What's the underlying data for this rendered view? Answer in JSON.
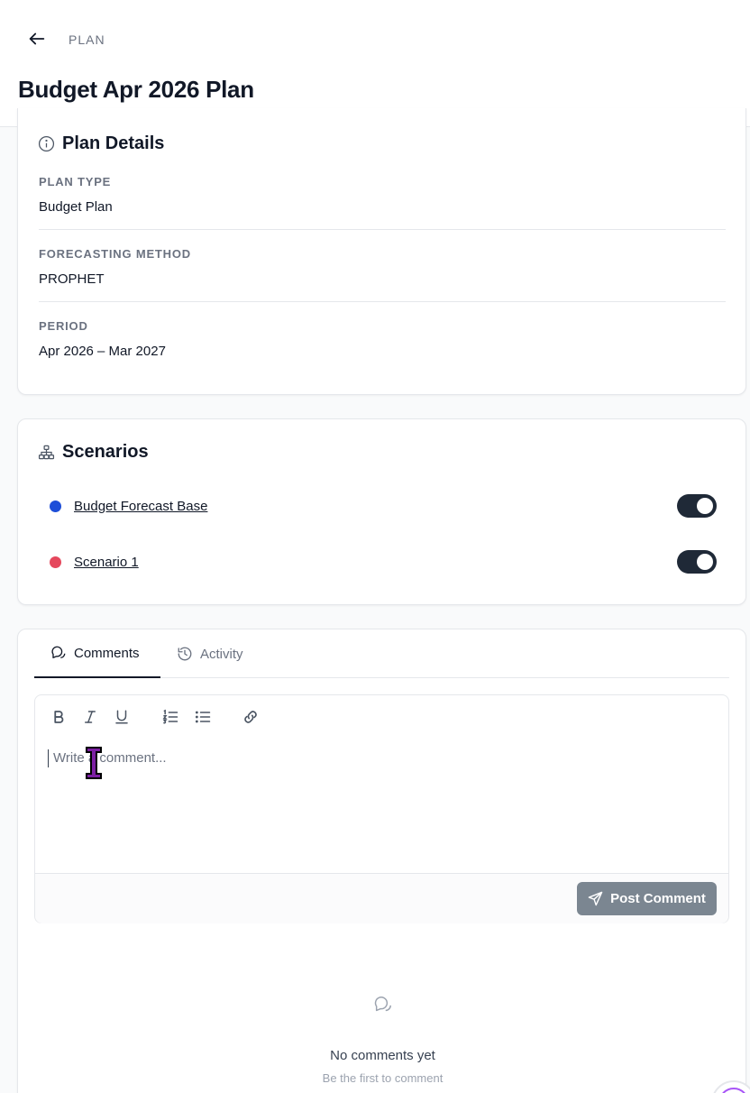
{
  "header": {
    "breadcrumb": "PLAN",
    "title": "Budget Apr 2026 Plan"
  },
  "details": {
    "title": "Plan Details",
    "fields": [
      {
        "label": "PLAN TYPE",
        "value": "Budget Plan"
      },
      {
        "label": "FORECASTING METHOD",
        "value": "PROPHET"
      },
      {
        "label": "PERIOD",
        "value": "Apr 2026 – Mar 2027"
      }
    ]
  },
  "scenarios": {
    "title": "Scenarios",
    "items": [
      {
        "name": "Budget Forecast Base",
        "color": "#1d4ed8",
        "enabled": true
      },
      {
        "name": "Scenario 1",
        "color": "#e5485d",
        "enabled": true
      }
    ]
  },
  "comments": {
    "tabs": [
      {
        "label": "Comments",
        "active": true
      },
      {
        "label": "Activity",
        "active": false
      }
    ],
    "toolbar": [
      "bold-icon",
      "italic-icon",
      "underline-icon",
      "ordered-list-icon",
      "bullet-list-icon",
      "link-icon"
    ],
    "placeholder": "Write a comment...",
    "post_label": "Post Comment",
    "empty_title": "No comments yet",
    "empty_subtitle": "Be the first to comment"
  }
}
